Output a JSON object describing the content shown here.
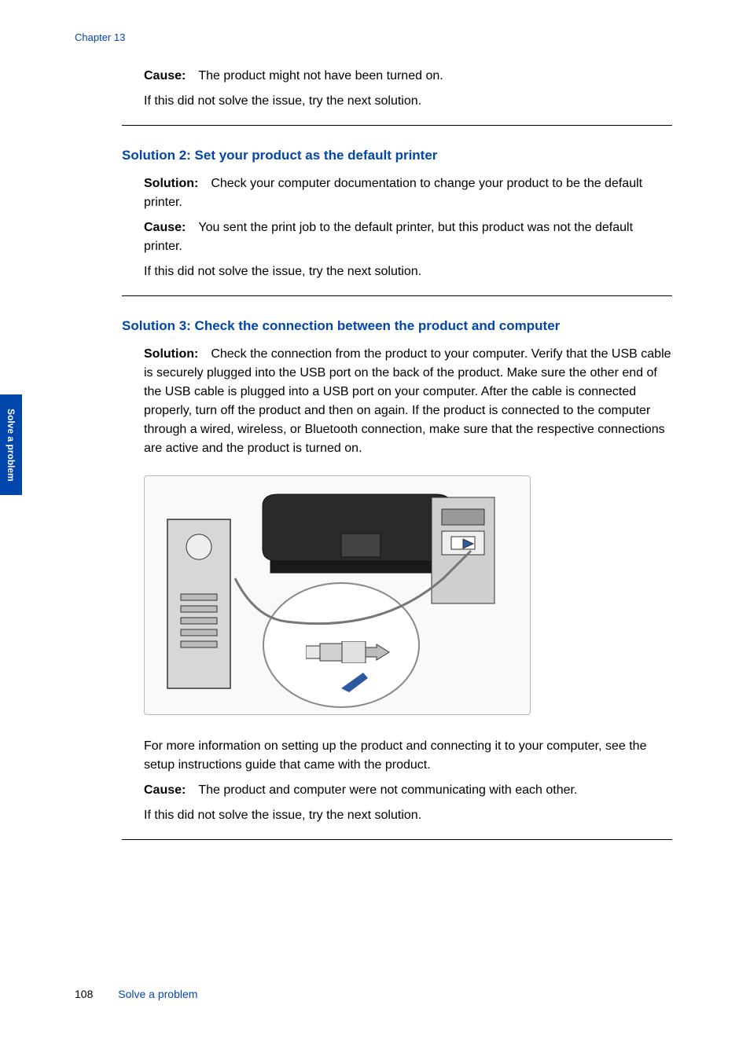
{
  "header": {
    "chapter": "Chapter 13"
  },
  "section1": {
    "cause_label": "Cause:",
    "cause_text": "The product might not have been turned on.",
    "retry": "If this did not solve the issue, try the next solution."
  },
  "section2": {
    "heading": "Solution 2: Set your product as the default printer",
    "solution_label": "Solution:",
    "solution_text": "Check your computer documentation to change your product to be the default printer.",
    "cause_label": "Cause:",
    "cause_text": "You sent the print job to the default printer, but this product was not the default printer.",
    "retry": "If this did not solve the issue, try the next solution."
  },
  "section3": {
    "heading": "Solution 3: Check the connection between the product and computer",
    "solution_label": "Solution:",
    "solution_text": "Check the connection from the product to your computer. Verify that the USB cable is securely plugged into the USB port on the back of the product. Make sure the other end of the USB cable is plugged into a USB port on your computer. After the cable is connected properly, turn off the product and then on again. If the product is connected to the computer through a wired, wireless, or Bluetooth connection, make sure that the respective connections are active and the product is turned on.",
    "more_info": "For more information on setting up the product and connecting it to your computer, see the setup instructions guide that came with the product.",
    "cause_label": "Cause:",
    "cause_text": "The product and computer were not communicating with each other.",
    "retry": "If this did not solve the issue, try the next solution."
  },
  "side_tab": "Solve a problem",
  "footer": {
    "page": "108",
    "title": "Solve a problem"
  },
  "figure": {
    "alt": "Diagram showing USB cable connection between computer tower, monitor/printer, and USB port detail"
  }
}
